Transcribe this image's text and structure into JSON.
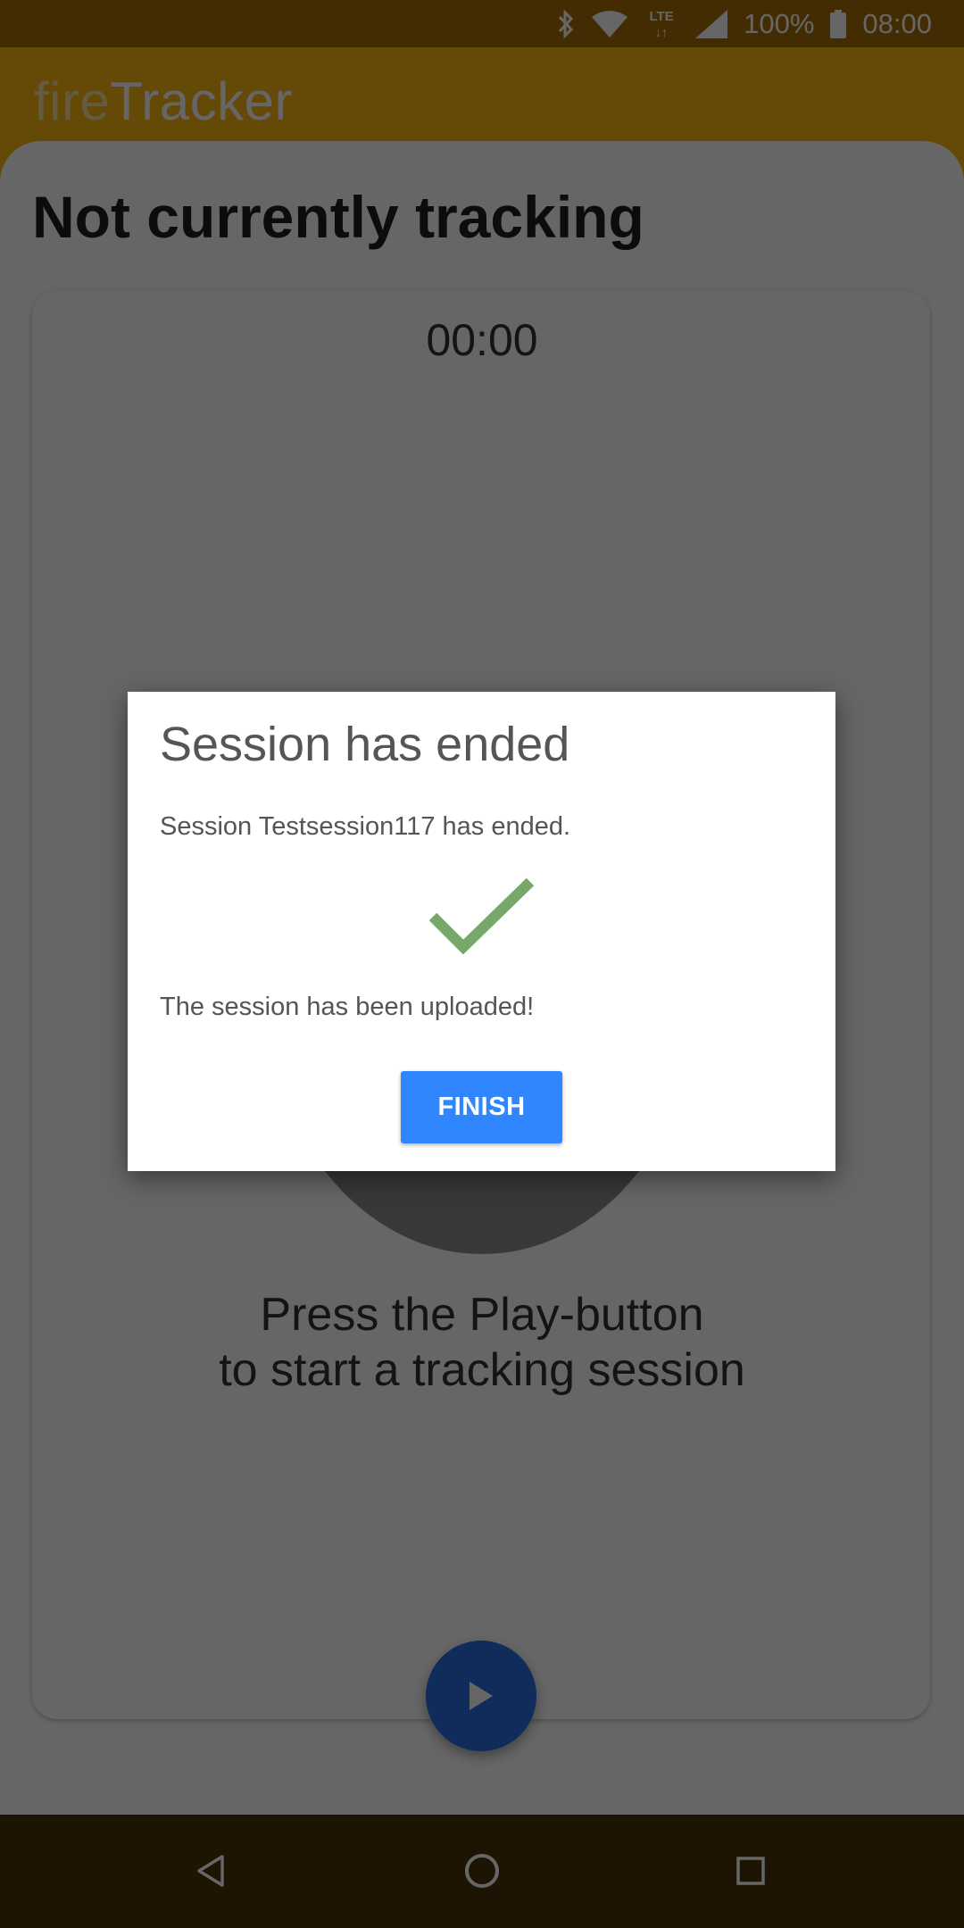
{
  "status_bar": {
    "battery": "100%",
    "time": "08:00",
    "network": "LTE",
    "icons": [
      "bluetooth-icon",
      "wifi-icon",
      "lte-icon",
      "signal-icon",
      "battery-icon"
    ]
  },
  "app_bar": {
    "title_light": "fire",
    "title_bold": "Tracker",
    "color": "#fbb811"
  },
  "main": {
    "heading": "Not currently tracking",
    "timer": "00:00",
    "prompt_line1": "Press the Play-button",
    "prompt_line2": "to start a tracking session",
    "play_icon": "play-icon"
  },
  "dialog": {
    "title": "Session has ended",
    "message": "Session Testsession117 has ended.",
    "status": "The session has been uploaded!",
    "finish_label": "FINISH",
    "check_color": "#76a86a",
    "button_color": "#2f86ff"
  },
  "nav_bar": {
    "icons": [
      "back-icon",
      "home-icon",
      "recents-icon"
    ]
  }
}
